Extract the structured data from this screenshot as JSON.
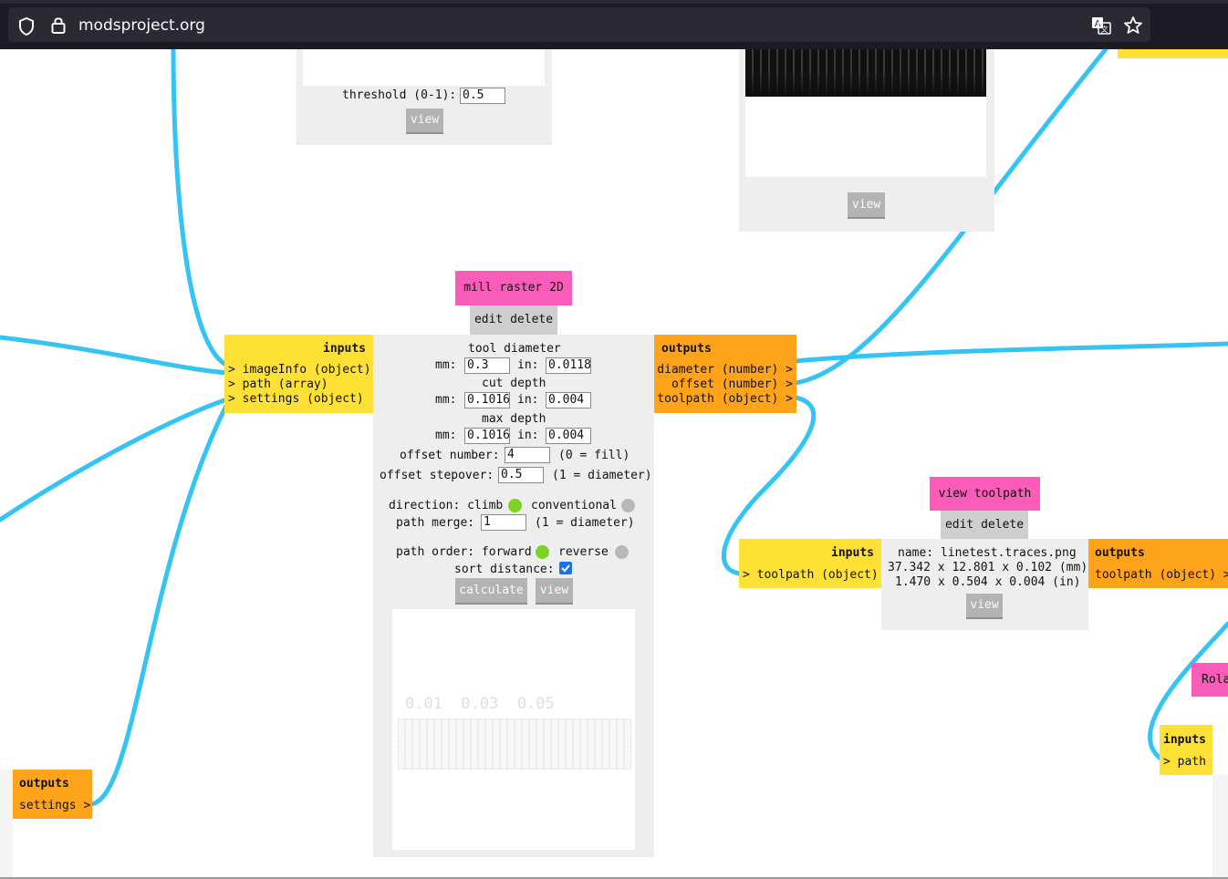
{
  "browser": {
    "url": "modsproject.org"
  },
  "modules": {
    "threshold": {
      "label": "threshold (0-1):",
      "value": "0.5",
      "view_button": "view"
    },
    "image_view": {
      "view_button": "view"
    },
    "mill_raster_2d": {
      "title": "mill raster 2D",
      "edit_delete": "edit delete",
      "inputs_header": "inputs",
      "inputs": [
        "> imageInfo (object)",
        "> path (array)",
        "> settings (object)"
      ],
      "outputs_header": "outputs",
      "outputs": [
        "diameter (number) >",
        "offset (number) >",
        "toolpath (object) >"
      ],
      "tool_diameter_label": "tool diameter",
      "tool_diameter_mm": "0.3",
      "tool_diameter_in": "0.0118",
      "cut_depth_label": "cut depth",
      "cut_depth_mm": "0.1016",
      "cut_depth_in": "0.004",
      "max_depth_label": "max depth",
      "max_depth_mm": "0.1016",
      "max_depth_in": "0.004",
      "mm_label": "mm:",
      "in_label": "in:",
      "offset_number_label": "offset number:",
      "offset_number": "4",
      "offset_number_note": "(0 = fill)",
      "offset_stepover_label": "offset stepover:",
      "offset_stepover": "0.5",
      "offset_stepover_note": "(1 = diameter)",
      "direction_label": "direction: climb",
      "conventional_label": "conventional",
      "path_merge_label": "path merge:",
      "path_merge": "1",
      "path_merge_note": "(1 = diameter)",
      "path_order_label": "path order: forward",
      "reverse_label": "reverse",
      "sort_distance_label": "sort distance:",
      "sort_distance_checked": true,
      "calculate_button": "calculate",
      "view_button": "view",
      "preview_text": "0.01  0.03  0.05"
    },
    "view_toolpath": {
      "title": "view toolpath",
      "edit_delete": "edit delete",
      "inputs_header": "inputs",
      "inputs": [
        "> toolpath (object)"
      ],
      "outputs_header": "outputs",
      "outputs": [
        "toolpath (object) >"
      ],
      "name_line": "name: linetest.traces.png",
      "mm_line": "37.342 x 12.801 x 0.102 (mm)",
      "in_line": "1.470 x 0.504 x 0.004 (in)",
      "view_button": "view"
    },
    "settings_source": {
      "outputs_header": "outputs",
      "outputs": [
        "settings >"
      ]
    },
    "roland": {
      "title": "Rola",
      "inputs_header": "inputs",
      "inputs": [
        "> path"
      ]
    }
  },
  "colors": {
    "wire": "#33c4f5",
    "module_title": "#fb5bb9",
    "inputs": "#ffe135",
    "outputs": "#ffa31a",
    "panel": "#eeeeee",
    "radio_on": "#7ed321",
    "radio_off": "#b8b8b8",
    "checkbox": "#1a73e8"
  },
  "icons": [
    "shield-icon",
    "lock-icon",
    "translate-icon",
    "bookmark-star-icon"
  ]
}
